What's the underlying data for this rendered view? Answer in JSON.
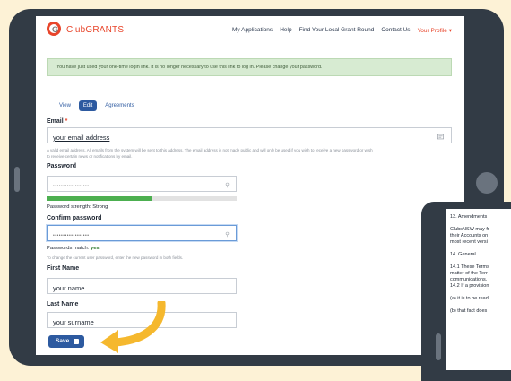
{
  "brand": {
    "logo_text": "ClubGRANTS",
    "logo_letter": "G",
    "accent_color": "#e8452b",
    "primary_color": "#2d5aa0"
  },
  "nav": {
    "items": [
      "My Applications",
      "Help",
      "Find Your Local Grant Round",
      "Contact Us"
    ],
    "profile": "Your Profile ▾"
  },
  "message": "You have just used your one-time login link. It is no longer necessary to use this link to log in. Please change your password.",
  "tabs": [
    "View",
    "Edit",
    "Agreements"
  ],
  "active_tab": "Edit",
  "form": {
    "email_label": "Email",
    "required_marker": "*",
    "email_value": "your email address",
    "email_help_1": "A valid email address. All emails from the system will be sent to this address. The email address is not made public and will only be used if you wish to receive a new password or wish",
    "email_help_2": "to receive certain news or notifications by email.",
    "password_label": "Password",
    "password_mask": "••••••••••••••••••",
    "password_strength": "Password strength: Strong",
    "password_strength_level": 0.55,
    "confirm_label": "Confirm password",
    "confirm_mask": "••••••••••••••••••",
    "match_label": "Passwords match:",
    "match_value": "yes",
    "change_help": "To change the current user password, enter the new password in both fields.",
    "first_name_label": "First Name",
    "first_name_value": "your name",
    "last_name_label": "Last Name",
    "last_name_value": "your surname",
    "save_label": "Save"
  },
  "phone": {
    "lines": [
      "13. Amendments",
      "ClubsNSW may fr",
      "their Accounts on",
      "most recent versi",
      "14. General",
      "14.1 These Terms",
      "matter of the Terr",
      "communications.",
      "14.2 If a provision",
      "(a) it is to be read",
      "(b) that fact does"
    ]
  }
}
